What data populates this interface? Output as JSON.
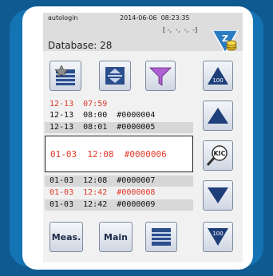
{
  "status": {
    "user": "autologin",
    "datetime": "2014-06-06  08:23:35",
    "coords": "[ -,  -,  -,  -]",
    "database_label": "Database: 28"
  },
  "toolbar": {
    "list_star_icon": "list-star-icon",
    "sort_icon": "sort-updown-icon",
    "filter_icon": "funnel-icon"
  },
  "records": [
    {
      "text": "12-13  07:59",
      "color": "red"
    },
    {
      "text": "12-13  08:00  #0000004",
      "color": "black"
    },
    {
      "text": "12-13  08:01  #0000005",
      "color": "black"
    },
    {
      "text": "01-03  12:08  #0000006",
      "color": "red",
      "selected": true
    },
    {
      "text": "01-03  12:08  #0000007",
      "color": "black"
    },
    {
      "text": "01-03  12:42  #0000008",
      "color": "red"
    },
    {
      "text": "01-03  12:42  #0000009",
      "color": "black"
    }
  ],
  "side_buttons": {
    "page_up_label": "100",
    "page_down_label": "100",
    "kic_label": "KIC"
  },
  "bottom": {
    "meas_label": "Meas.",
    "main_label": "Main"
  },
  "colors": {
    "accent_blue": "#1f3f7a",
    "record_red": "#e03a2a",
    "frame_blue": "#1473b3"
  }
}
